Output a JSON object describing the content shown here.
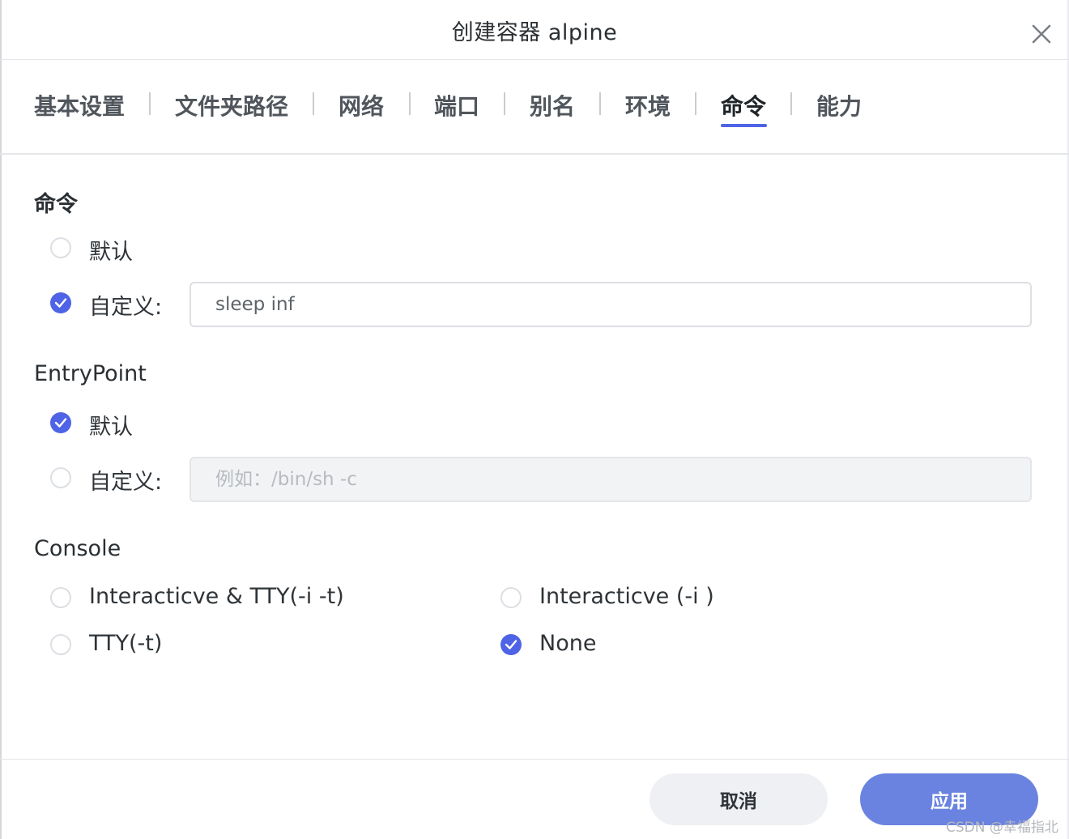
{
  "dialog": {
    "title": "创建容器 alpine"
  },
  "tabs": [
    {
      "label": "基本设置",
      "active": false
    },
    {
      "label": "文件夹路径",
      "active": false
    },
    {
      "label": "网络",
      "active": false
    },
    {
      "label": "端口",
      "active": false
    },
    {
      "label": "别名",
      "active": false
    },
    {
      "label": "环境",
      "active": false
    },
    {
      "label": "命令",
      "active": true
    },
    {
      "label": "能力",
      "active": false
    }
  ],
  "command": {
    "title": "命令",
    "default_label": "默认",
    "custom_label": "自定义:",
    "selected": "custom",
    "value": "sleep inf",
    "placeholder": ""
  },
  "entrypoint": {
    "title": "EntryPoint",
    "default_label": "默认",
    "custom_label": "自定义:",
    "selected": "default",
    "value": "",
    "placeholder": "例如：/bin/sh -c"
  },
  "console": {
    "title": "Console",
    "options": [
      {
        "label": "Interacticve & TTY(-i -t)",
        "checked": false
      },
      {
        "label": "Interacticve (-i )",
        "checked": false
      },
      {
        "label": "TTY(-t)",
        "checked": false
      },
      {
        "label": "None",
        "checked": true
      }
    ]
  },
  "footer": {
    "cancel_label": "取消",
    "apply_label": "应用"
  },
  "watermark": "CSDN @幸福指北",
  "colors": {
    "accent": "#4f63e6",
    "apply_button": "#6a83e0",
    "cancel_button": "#eef0f3"
  }
}
